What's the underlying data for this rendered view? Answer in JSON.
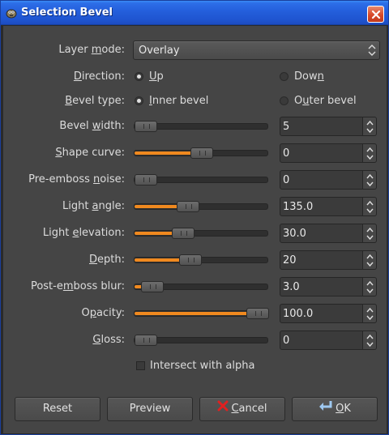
{
  "window": {
    "title": "Selection Bevel"
  },
  "colors": {
    "accent": "#f0891f",
    "titlebar": "#245edb",
    "background": "#454545"
  },
  "icons": {
    "title": "gimp-icon",
    "close": "close-icon",
    "cancel": "cancel-x-icon",
    "ok": "ok-arrow-icon"
  },
  "layer_mode": {
    "label_pre": "Layer ",
    "label_u": "m",
    "label_post": "ode:",
    "value": "Overlay"
  },
  "direction": {
    "label_pre": "",
    "label_u": "D",
    "label_post": "irection:",
    "options": [
      {
        "pre": "",
        "u": "U",
        "post": "p",
        "selected": true
      },
      {
        "pre": "Dow",
        "u": "n",
        "post": "",
        "selected": false
      }
    ]
  },
  "bevel_type": {
    "label_pre": "",
    "label_u": "B",
    "label_post": "evel type:",
    "options": [
      {
        "pre": "",
        "u": "I",
        "post": "nner bevel",
        "selected": true
      },
      {
        "pre": "O",
        "u": "u",
        "post": "ter bevel",
        "selected": false
      }
    ]
  },
  "sliders": [
    {
      "pre": "Bevel ",
      "u": "w",
      "post": "idth:",
      "value": "5",
      "fraction": 0.0
    },
    {
      "pre": "",
      "u": "S",
      "post": "hape curve:",
      "value": "0",
      "fraction": 0.5
    },
    {
      "pre": "Pre-emboss ",
      "u": "n",
      "post": "oise:",
      "value": "0",
      "fraction": 0.0
    },
    {
      "pre": "Light ",
      "u": "a",
      "post": "ngle:",
      "value": "135.0",
      "fraction": 0.375
    },
    {
      "pre": "Light ",
      "u": "e",
      "post": "levation:",
      "value": "30.0",
      "fraction": 0.33
    },
    {
      "pre": "",
      "u": "D",
      "post": "epth:",
      "value": "20",
      "fraction": 0.4
    },
    {
      "pre": "Post-e",
      "u": "m",
      "post": "boss blur:",
      "value": "3.0",
      "fraction": 0.06
    },
    {
      "pre": "O",
      "u": "p",
      "post": "acity:",
      "value": "100.0",
      "fraction": 1.0
    },
    {
      "pre": "",
      "u": "G",
      "post": "loss:",
      "value": "0",
      "fraction": 0.0
    }
  ],
  "intersect": {
    "label": "Intersect with alpha",
    "checked": false
  },
  "buttons": {
    "reset": "Reset",
    "preview": "Preview",
    "cancel_u": "C",
    "cancel_post": "ancel",
    "ok_u": "O",
    "ok_post": "K"
  }
}
